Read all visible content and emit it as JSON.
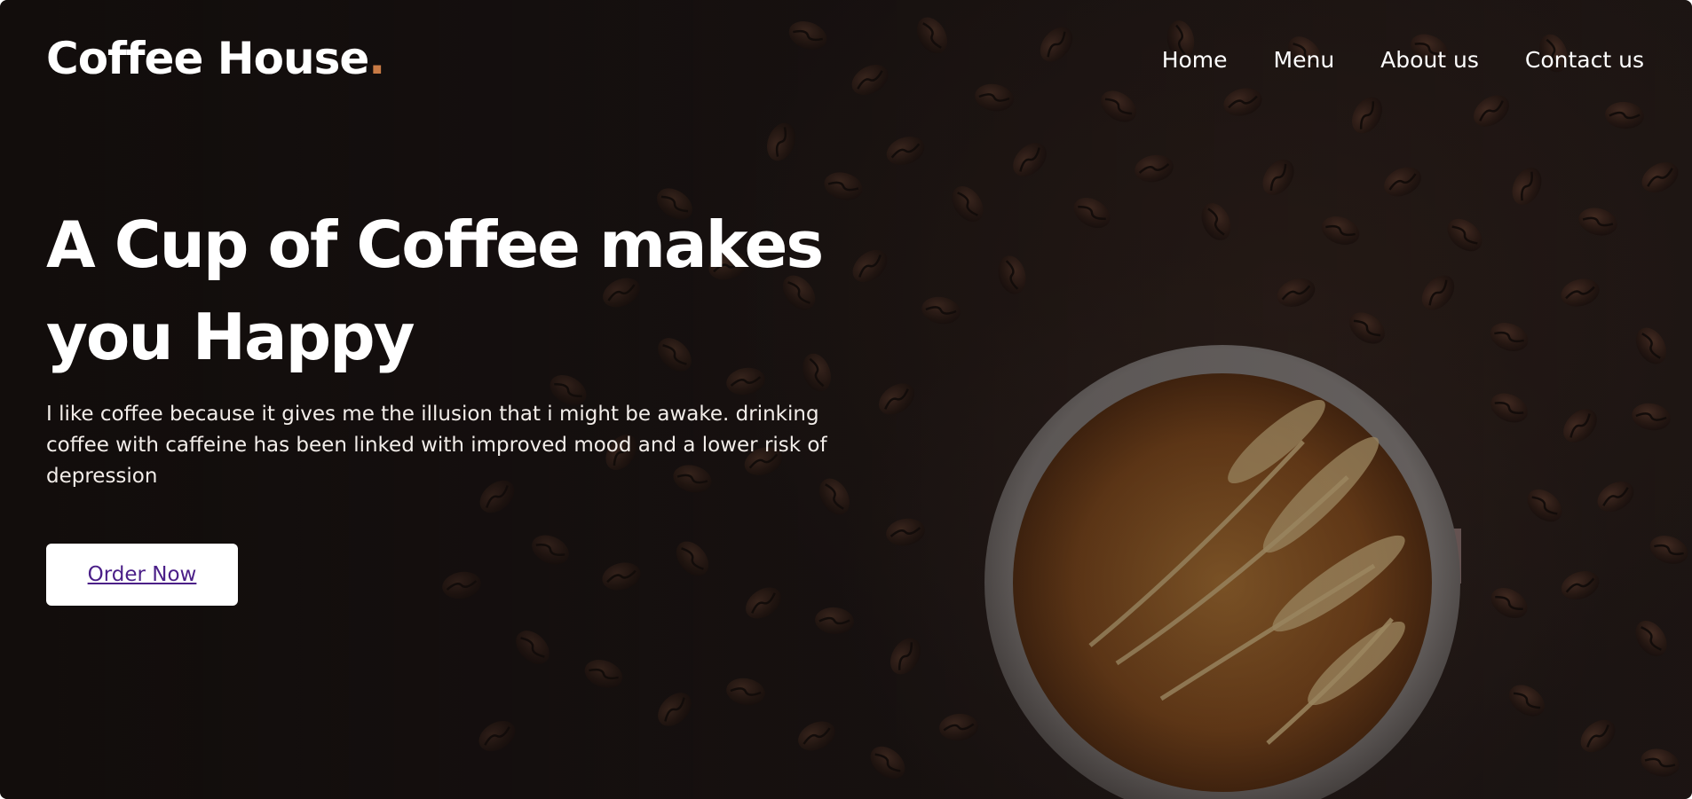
{
  "brand": {
    "name": "Coffee House",
    "dot": ".",
    "accent_color": "#c87a45"
  },
  "nav": {
    "items": [
      {
        "label": "Home"
      },
      {
        "label": "Menu"
      },
      {
        "label": "About us"
      },
      {
        "label": "Contact us"
      }
    ]
  },
  "hero": {
    "headline": "A Cup of Coffee makes you Happy",
    "tagline": "I like coffee because it gives me the illusion that i might be awake. drinking coffee with caffeine has been linked with improved mood and a lower risk of depression",
    "cta_label": "Order Now",
    "cta_color": "#4b1f88",
    "background_image": "coffee-beans-and-latte-art-cup"
  }
}
